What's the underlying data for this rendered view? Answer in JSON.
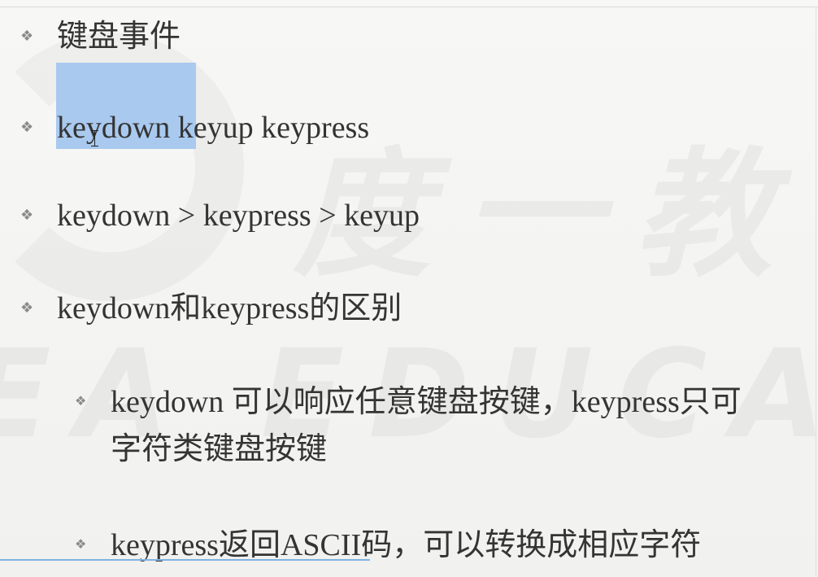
{
  "slide": {
    "watermark": {
      "chinese": "度一教",
      "english": "EA EDUCATI"
    },
    "items": [
      {
        "level": 1,
        "text": "键盘事件"
      },
      {
        "level": 1,
        "text": "keydown keyup keypress"
      },
      {
        "level": 1,
        "text": "keydown > keypress > keyup"
      },
      {
        "level": 1,
        "text": "keydown和keypress的区别"
      },
      {
        "level": 2,
        "line1": "keydown 可以响应任意键盘按键，keypress只可",
        "line2": "字符类键盘按键"
      },
      {
        "level": 2,
        "text": "keypress返回ASCII码，可以转换成相应字符"
      }
    ]
  },
  "colors": {
    "background": "#f4f4f2",
    "text": "#343434",
    "bullet": "#8a8a8a",
    "selection": "#a9c9ef",
    "progress_line": "#7fb2e0"
  }
}
